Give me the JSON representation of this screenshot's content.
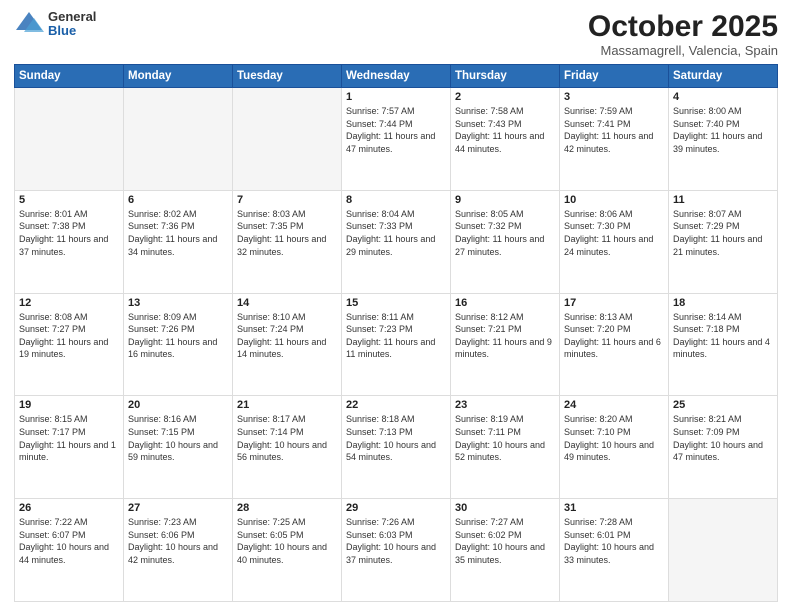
{
  "header": {
    "logo_general": "General",
    "logo_blue": "Blue",
    "month": "October 2025",
    "location": "Massamagrell, Valencia, Spain"
  },
  "weekdays": [
    "Sunday",
    "Monday",
    "Tuesday",
    "Wednesday",
    "Thursday",
    "Friday",
    "Saturday"
  ],
  "weeks": [
    [
      {
        "day": "",
        "info": ""
      },
      {
        "day": "",
        "info": ""
      },
      {
        "day": "",
        "info": ""
      },
      {
        "day": "1",
        "info": "Sunrise: 7:57 AM\nSunset: 7:44 PM\nDaylight: 11 hours and 47 minutes."
      },
      {
        "day": "2",
        "info": "Sunrise: 7:58 AM\nSunset: 7:43 PM\nDaylight: 11 hours and 44 minutes."
      },
      {
        "day": "3",
        "info": "Sunrise: 7:59 AM\nSunset: 7:41 PM\nDaylight: 11 hours and 42 minutes."
      },
      {
        "day": "4",
        "info": "Sunrise: 8:00 AM\nSunset: 7:40 PM\nDaylight: 11 hours and 39 minutes."
      }
    ],
    [
      {
        "day": "5",
        "info": "Sunrise: 8:01 AM\nSunset: 7:38 PM\nDaylight: 11 hours and 37 minutes."
      },
      {
        "day": "6",
        "info": "Sunrise: 8:02 AM\nSunset: 7:36 PM\nDaylight: 11 hours and 34 minutes."
      },
      {
        "day": "7",
        "info": "Sunrise: 8:03 AM\nSunset: 7:35 PM\nDaylight: 11 hours and 32 minutes."
      },
      {
        "day": "8",
        "info": "Sunrise: 8:04 AM\nSunset: 7:33 PM\nDaylight: 11 hours and 29 minutes."
      },
      {
        "day": "9",
        "info": "Sunrise: 8:05 AM\nSunset: 7:32 PM\nDaylight: 11 hours and 27 minutes."
      },
      {
        "day": "10",
        "info": "Sunrise: 8:06 AM\nSunset: 7:30 PM\nDaylight: 11 hours and 24 minutes."
      },
      {
        "day": "11",
        "info": "Sunrise: 8:07 AM\nSunset: 7:29 PM\nDaylight: 11 hours and 21 minutes."
      }
    ],
    [
      {
        "day": "12",
        "info": "Sunrise: 8:08 AM\nSunset: 7:27 PM\nDaylight: 11 hours and 19 minutes."
      },
      {
        "day": "13",
        "info": "Sunrise: 8:09 AM\nSunset: 7:26 PM\nDaylight: 11 hours and 16 minutes."
      },
      {
        "day": "14",
        "info": "Sunrise: 8:10 AM\nSunset: 7:24 PM\nDaylight: 11 hours and 14 minutes."
      },
      {
        "day": "15",
        "info": "Sunrise: 8:11 AM\nSunset: 7:23 PM\nDaylight: 11 hours and 11 minutes."
      },
      {
        "day": "16",
        "info": "Sunrise: 8:12 AM\nSunset: 7:21 PM\nDaylight: 11 hours and 9 minutes."
      },
      {
        "day": "17",
        "info": "Sunrise: 8:13 AM\nSunset: 7:20 PM\nDaylight: 11 hours and 6 minutes."
      },
      {
        "day": "18",
        "info": "Sunrise: 8:14 AM\nSunset: 7:18 PM\nDaylight: 11 hours and 4 minutes."
      }
    ],
    [
      {
        "day": "19",
        "info": "Sunrise: 8:15 AM\nSunset: 7:17 PM\nDaylight: 11 hours and 1 minute."
      },
      {
        "day": "20",
        "info": "Sunrise: 8:16 AM\nSunset: 7:15 PM\nDaylight: 10 hours and 59 minutes."
      },
      {
        "day": "21",
        "info": "Sunrise: 8:17 AM\nSunset: 7:14 PM\nDaylight: 10 hours and 56 minutes."
      },
      {
        "day": "22",
        "info": "Sunrise: 8:18 AM\nSunset: 7:13 PM\nDaylight: 10 hours and 54 minutes."
      },
      {
        "day": "23",
        "info": "Sunrise: 8:19 AM\nSunset: 7:11 PM\nDaylight: 10 hours and 52 minutes."
      },
      {
        "day": "24",
        "info": "Sunrise: 8:20 AM\nSunset: 7:10 PM\nDaylight: 10 hours and 49 minutes."
      },
      {
        "day": "25",
        "info": "Sunrise: 8:21 AM\nSunset: 7:09 PM\nDaylight: 10 hours and 47 minutes."
      }
    ],
    [
      {
        "day": "26",
        "info": "Sunrise: 7:22 AM\nSunset: 6:07 PM\nDaylight: 10 hours and 44 minutes."
      },
      {
        "day": "27",
        "info": "Sunrise: 7:23 AM\nSunset: 6:06 PM\nDaylight: 10 hours and 42 minutes."
      },
      {
        "day": "28",
        "info": "Sunrise: 7:25 AM\nSunset: 6:05 PM\nDaylight: 10 hours and 40 minutes."
      },
      {
        "day": "29",
        "info": "Sunrise: 7:26 AM\nSunset: 6:03 PM\nDaylight: 10 hours and 37 minutes."
      },
      {
        "day": "30",
        "info": "Sunrise: 7:27 AM\nSunset: 6:02 PM\nDaylight: 10 hours and 35 minutes."
      },
      {
        "day": "31",
        "info": "Sunrise: 7:28 AM\nSunset: 6:01 PM\nDaylight: 10 hours and 33 minutes."
      },
      {
        "day": "",
        "info": ""
      }
    ]
  ]
}
